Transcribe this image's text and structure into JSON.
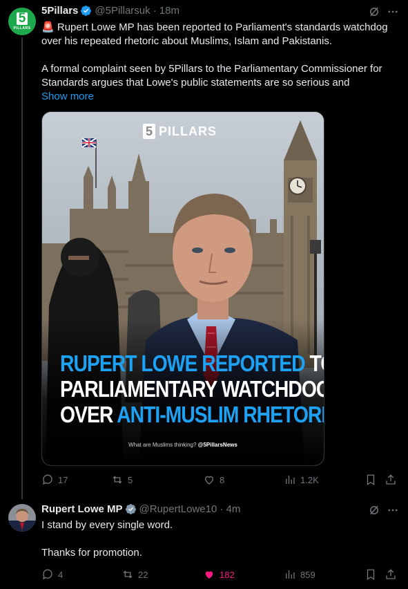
{
  "tweet1": {
    "name": "5Pillars",
    "handle": "@5Pillarsuk",
    "time": "· 18m",
    "avatar_text": "5",
    "avatar_sub": "PILLARS",
    "alert_emoji": "🚨",
    "line1": "Rupert Lowe MP has been reported to Parliament's standards watchdog",
    "line2": "over his repeated rhetoric about Muslims, Islam and Pakistanis.",
    "para2_line1": "A formal complaint seen by 5Pillars to the Parliamentary Commissioner for",
    "para2_line2": "Standards argues that Lowe's public statements are so serious and",
    "show_more": "Show more",
    "media": {
      "logo_num": "5",
      "logo_text": "PILLARS",
      "headline_l1_blue": "RUPERT LOWE REPORTED",
      "headline_l1_white": "TO",
      "headline_l2": "PARLIAMENTARY WATCHDOG",
      "headline_l3_white": "OVER",
      "headline_l3_blue": "ANTI-MUSLIM RHETORIC",
      "footer_text": "What are Muslims thinking?",
      "footer_handle": "@5PillarsNews"
    },
    "stats": {
      "replies": "17",
      "reposts": "5",
      "likes": "8",
      "views": "1.2K"
    }
  },
  "tweet2": {
    "name": "Rupert Lowe MP",
    "handle": "@RupertLowe10",
    "time": "· 4m",
    "line1": "I stand by every single word.",
    "line2": "Thanks for promotion.",
    "stats": {
      "replies": "4",
      "reposts": "22",
      "likes": "182",
      "views": "859"
    }
  },
  "colors": {
    "accent": "#1d9bf0",
    "liked": "#f91880",
    "muted": "#71767b",
    "verified_blue": "#1d9bf0",
    "verified_grey": "#829aab"
  }
}
